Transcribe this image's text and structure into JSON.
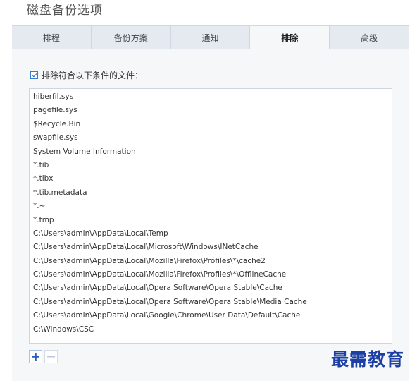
{
  "window": {
    "title": "磁盘备份选项"
  },
  "tabs": [
    {
      "label": "排程",
      "active": false
    },
    {
      "label": "备份方案",
      "active": false
    },
    {
      "label": "通知",
      "active": false
    },
    {
      "label": "排除",
      "active": true
    },
    {
      "label": "高级",
      "active": false
    }
  ],
  "exclude": {
    "checkbox_label": "排除符合以下条件的文件：",
    "checked": true,
    "items": [
      "hiberfil.sys",
      "pagefile.sys",
      "$Recycle.Bin",
      "swapfile.sys",
      "System Volume Information",
      "*.tib",
      "*.tibx",
      "*.tib.metadata",
      "*.~",
      "*.tmp",
      "C:\\Users\\admin\\AppData\\Local\\Temp",
      "C:\\Users\\admin\\AppData\\Local\\Microsoft\\Windows\\INetCache",
      "C:\\Users\\admin\\AppData\\Local\\Mozilla\\Firefox\\Profiles\\*\\cache2",
      "C:\\Users\\admin\\AppData\\Local\\Mozilla\\Firefox\\Profiles\\*\\OfflineCache",
      "C:\\Users\\admin\\AppData\\Local\\Opera Software\\Opera Stable\\Cache",
      "C:\\Users\\admin\\AppData\\Local\\Opera Software\\Opera Stable\\Media Cache",
      "C:\\Users\\admin\\AppData\\Local\\Google\\Chrome\\User Data\\Default\\Cache",
      "C:\\Windows\\CSC"
    ]
  },
  "buttons": {
    "add_icon": "plus-icon",
    "remove_icon": "minus-icon"
  },
  "colors": {
    "accent": "#2a67c0",
    "tab_bar": "#e4eaf0",
    "panel": "#f5f7f9",
    "watermark": "#1b3fa3"
  },
  "watermark": {
    "text": "最需教育"
  }
}
